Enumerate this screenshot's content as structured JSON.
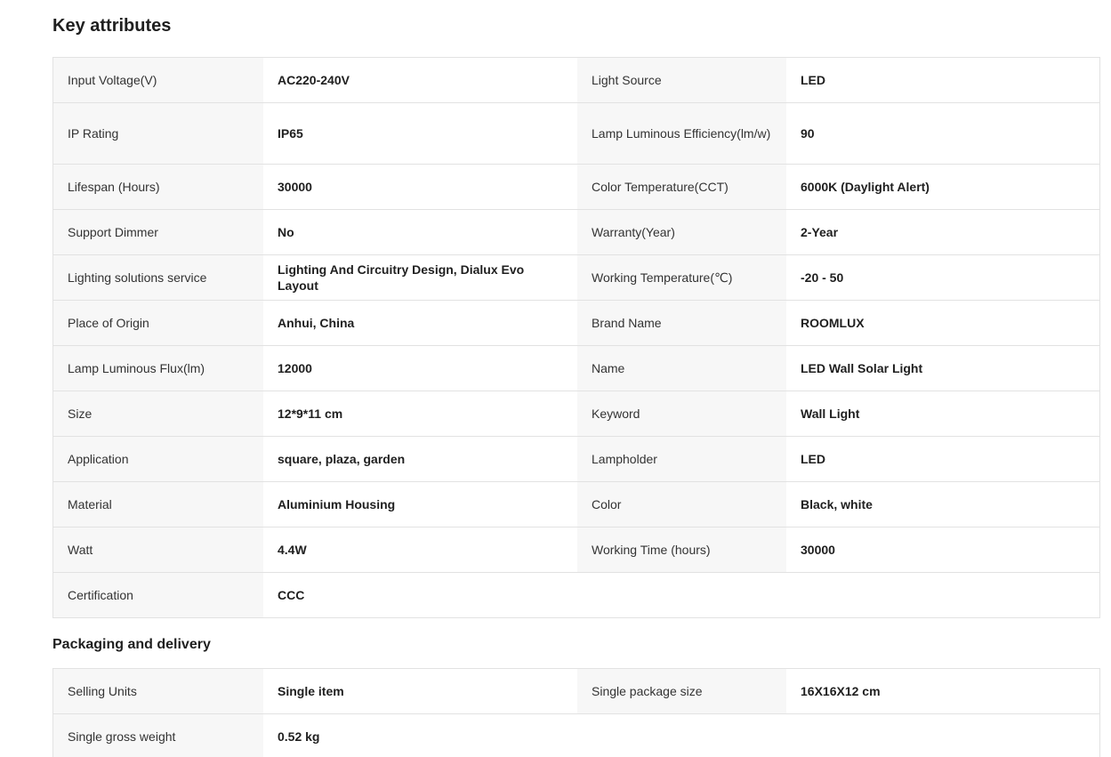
{
  "key_attributes": {
    "title": "Key attributes",
    "rows": [
      {
        "l1": "Input Voltage(V)",
        "v1": "AC220-240V",
        "l2": "Light Source",
        "v2": "LED"
      },
      {
        "l1": "IP Rating",
        "v1": "IP65",
        "l2": "Lamp Luminous Efficiency(lm/w)",
        "v2": "90"
      },
      {
        "l1": "Lifespan (Hours)",
        "v1": "30000",
        "l2": "Color Temperature(CCT)",
        "v2": "6000K (Daylight Alert)"
      },
      {
        "l1": "Support Dimmer",
        "v1": "No",
        "l2": "Warranty(Year)",
        "v2": "2-Year"
      },
      {
        "l1": "Lighting solutions service",
        "v1": "Lighting And Circuitry Design, Dialux Evo Layout",
        "l2": "Working Temperature(℃)",
        "v2": "-20 - 50"
      },
      {
        "l1": "Place of Origin",
        "v1": "Anhui, China",
        "l2": "Brand Name",
        "v2": "ROOMLUX"
      },
      {
        "l1": "Lamp Luminous Flux(lm)",
        "v1": "12000",
        "l2": "Name",
        "v2": "LED Wall Solar Light"
      },
      {
        "l1": "Size",
        "v1": "12*9*11 cm",
        "l2": "Keyword",
        "v2": "Wall Light"
      },
      {
        "l1": "Application",
        "v1": "square, plaza, garden",
        "l2": "Lampholder",
        "v2": "LED"
      },
      {
        "l1": "Material",
        "v1": "Aluminium Housing",
        "l2": "Color",
        "v2": "Black, white"
      },
      {
        "l1": "Watt",
        "v1": "4.4W",
        "l2": "Working Time (hours)",
        "v2": "30000"
      },
      {
        "l1": "Certification",
        "v1": "CCC",
        "l2": "",
        "v2": ""
      }
    ]
  },
  "packaging": {
    "title": "Packaging and delivery",
    "rows": [
      {
        "l1": "Selling Units",
        "v1": "Single item",
        "l2": "Single package size",
        "v2": "16X16X12 cm"
      },
      {
        "l1": "Single gross weight",
        "v1": "0.52 kg",
        "l2": "",
        "v2": ""
      }
    ]
  }
}
